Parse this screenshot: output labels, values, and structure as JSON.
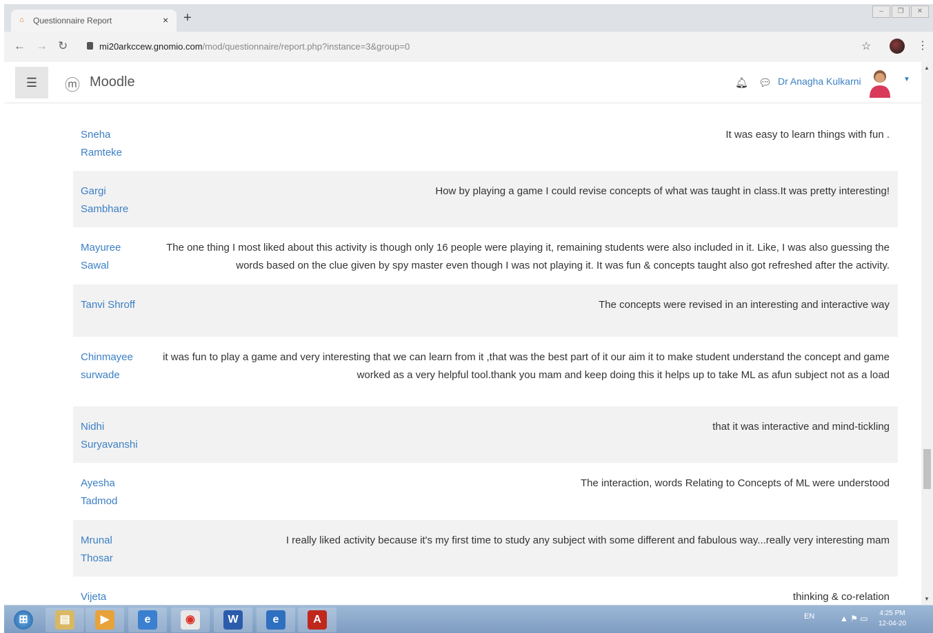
{
  "browser": {
    "tab_title": "Questionnaire Report",
    "tab_close": "×",
    "new_tab": "+",
    "url_host": "mi20arkccew.gnomio.com",
    "url_path": "/mod/questionnaire/report.php?instance=3&group=0",
    "window_controls": [
      "–",
      "❐",
      "✕"
    ]
  },
  "header": {
    "menu_icon": "☰",
    "brand": "Moodle",
    "user_name": "Dr Anagha Kulkarni"
  },
  "responses": [
    {
      "first": "Sneha",
      "last": "Ramteke",
      "answer": [
        "It was easy to learn things with fun ."
      ]
    },
    {
      "first": "Gargi",
      "last": "Sambhare",
      "answer": [
        "How by playing a game I could revise concepts of what was taught in class.It was pretty interesting!"
      ]
    },
    {
      "first": "Mayuree",
      "last": "Sawal",
      "answer": [
        "The one thing I most liked about this activity is though only 16 people were playing it, remaining students were also included in it. Like, I was also guessing the",
        "words based on the clue given by spy master even though I was not playing it. It was fun & concepts taught also got refreshed after the activity."
      ]
    },
    {
      "first": "Tanvi Shroff",
      "last": "",
      "answer": [
        "The concepts were revised in an interesting and interactive way"
      ]
    },
    {
      "first": "Chinmayee",
      "last": "surwade",
      "answer": [
        "it was fun to play a game and very interesting that we can learn from it ,that was the best part of it our aim it to make student understand the concept and game",
        "worked as a very helpful tool.thank you mam and keep doing this it helps up to take ML as afun subject not as a load"
      ]
    },
    {
      "first": "Nidhi",
      "last": "Suryavanshi",
      "answer": [
        "that it was interactive and mind-tickling"
      ]
    },
    {
      "first": "Ayesha",
      "last": "Tadmod",
      "answer": [
        "The interaction, words Relating to Concepts of ML were understood"
      ]
    },
    {
      "first": "Mrunal",
      "last": "Thosar",
      "answer": [
        "I really liked activity because it's my first time to study any subject with some different and fabulous way...really very interesting mam"
      ]
    },
    {
      "first": "Vijeta",
      "last": "",
      "answer": [
        "thinking & co-relation"
      ]
    }
  ],
  "taskbar": {
    "items": [
      "start",
      "folder",
      "media-player",
      "internet-explorer",
      "chrome",
      "word",
      "ie-edge",
      "acrobat"
    ],
    "glyphs": [
      "⊞",
      "▤",
      "▶",
      "e",
      "◉",
      "W",
      "e",
      "A"
    ],
    "language": "EN",
    "time": "4:25 PM",
    "date": "12-04-20"
  },
  "colors": {
    "link": "#3b7fc4",
    "row_shade": "#f2f2f2",
    "taskbar": "#8aa9cc"
  }
}
